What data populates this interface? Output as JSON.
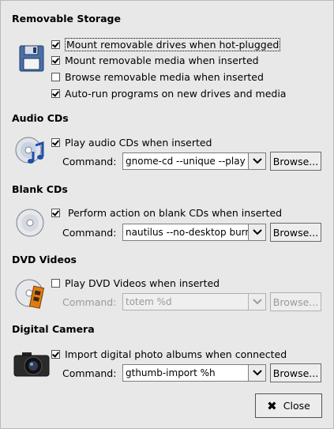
{
  "removable_storage": {
    "title": "Removable Storage",
    "options": [
      {
        "label": "Mount removable drives when hot-plugged",
        "checked": true
      },
      {
        "label": "Mount removable media when inserted",
        "checked": true
      },
      {
        "label": "Browse removable media when inserted",
        "checked": false
      },
      {
        "label": "Auto-run programs on new drives and media",
        "checked": true
      }
    ]
  },
  "audio_cds": {
    "title": "Audio CDs",
    "option": {
      "label": "Play audio CDs when inserted",
      "checked": true
    },
    "command_label": "Command:",
    "command_value": "gnome-cd --unique --play -",
    "browse_label": "Browse..."
  },
  "blank_cds": {
    "title": "Blank CDs",
    "option": {
      "label": "Perform action on blank CDs when inserted",
      "checked": true
    },
    "command_label": "Command:",
    "command_value": "nautilus --no-desktop burn:",
    "browse_label": "Browse..."
  },
  "dvd_videos": {
    "title": "DVD Videos",
    "option": {
      "label": "Play DVD Videos when inserted",
      "checked": false
    },
    "command_label": "Command:",
    "command_value": "totem %d",
    "browse_label": "Browse..."
  },
  "digital_camera": {
    "title": "Digital Camera",
    "option": {
      "label": "Import digital photo albums when connected",
      "checked": true
    },
    "command_label": "Command:",
    "command_value": "gthumb-import %h",
    "browse_label": "Browse..."
  },
  "close_label": "Close",
  "icons": {
    "removable": "floppy-disk-icon",
    "audio": "audio-cd-icon",
    "blank": "blank-cd-icon",
    "dvd": "dvd-video-icon",
    "camera": "camera-icon",
    "close": "close-x-icon"
  }
}
